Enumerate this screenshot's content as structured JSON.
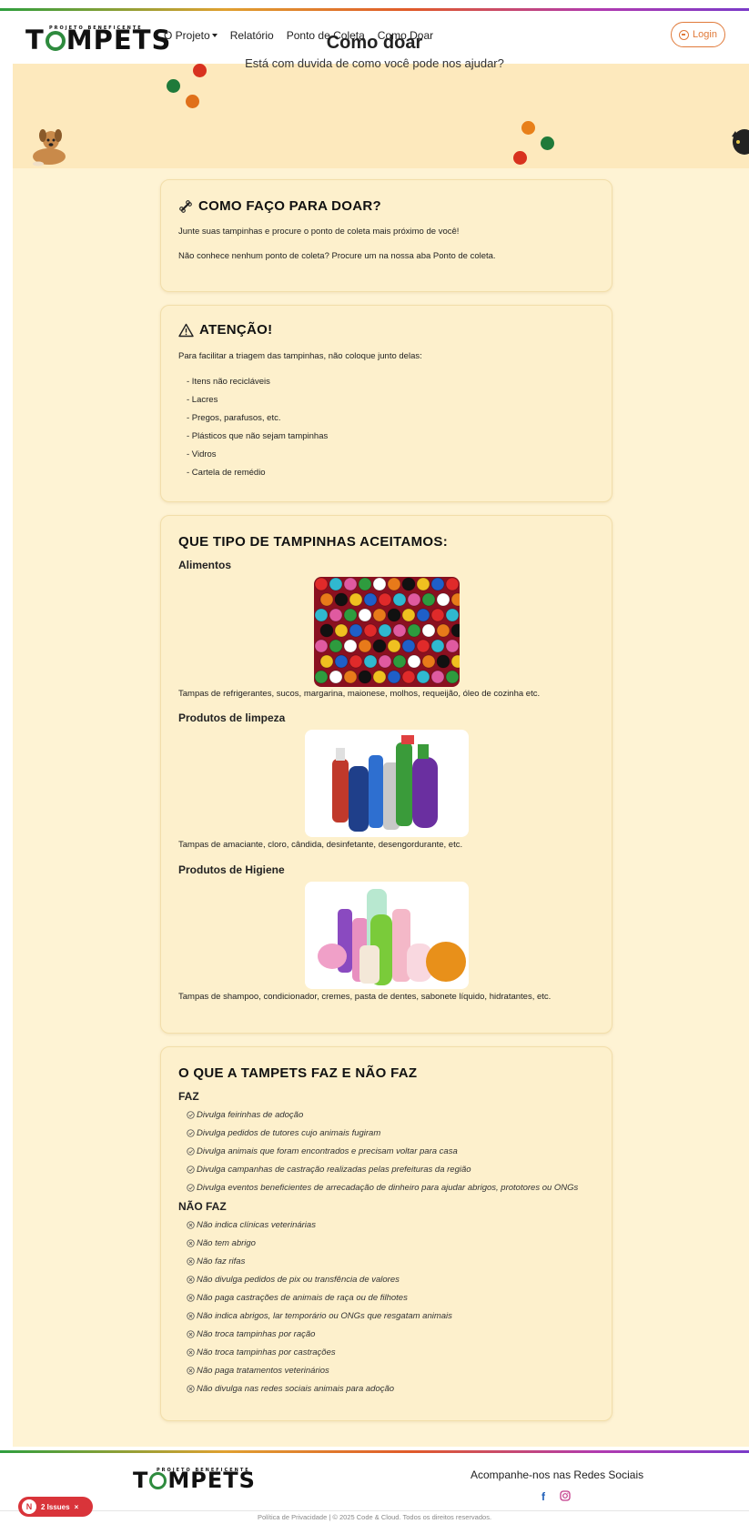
{
  "nav": {
    "logo_small": "PROJETO BENEFICENTE",
    "logo_text_before": "T",
    "logo_text_after": "MPETS",
    "links": [
      {
        "label": "O Projeto"
      },
      {
        "label": "Relatório"
      },
      {
        "label": "Ponto de Coleta"
      },
      {
        "label": "Como Doar"
      }
    ],
    "login_label": "Login"
  },
  "hero": {
    "title": "Como doar",
    "subtitle": "Está com duvida de como você pode nos ajudar?"
  },
  "card_como": {
    "title": "COMO FAÇO PARA DOAR?",
    "p1": "Junte suas tampinhas e procure o ponto de coleta mais próximo de você!",
    "p2": "Não conhece nenhum ponto de coleta? Procure um na nossa aba Ponto de coleta."
  },
  "card_atencao": {
    "title": "ATENÇÃO!",
    "intro": "Para facilitar a triagem das tampinhas, não coloque junto delas:",
    "items": [
      "- Itens não recicláveis",
      "- Lacres",
      "- Pregos, parafusos, etc.",
      "- Plásticos que não sejam tampinhas",
      "- Vidros",
      "- Cartela de remédio"
    ]
  },
  "card_tipos": {
    "title": "QUE TIPO DE TAMPINHAS ACEITAMOS:",
    "sections": [
      {
        "heading": "Alimentos",
        "caption": "Tampas de refrigerantes, sucos, margarina, maionese, molhos, requeijão, óleo de cozinha etc."
      },
      {
        "heading": "Produtos de limpeza",
        "caption": "Tampas de amaciante, cloro, cândida, desinfetante, desengordurante, etc."
      },
      {
        "heading": "Produtos de Higiene",
        "caption": "Tampas de shampoo, condicionador, cremes, pasta de dentes, sabonete líquido, hidratantes, etc."
      }
    ]
  },
  "card_faz": {
    "title": "O QUE A TAMPETS FAZ E NÃO FAZ",
    "faz_heading": "FAZ",
    "faz_items": [
      "Divulga feirinhas de adoção",
      "Divulga pedidos de tutores cujo animais fugiram",
      "Divulga animais que foram encontrados e precisam voltar para casa",
      "Divulga campanhas de castração realizadas pelas prefeituras da região",
      "Divulga eventos beneficientes de arrecadação de dinheiro para ajudar abrigos, prototores ou ONGs"
    ],
    "nao_faz_heading": "NÃO FAZ",
    "nao_faz_items": [
      "Não indica clínicas veterinárias",
      "Não tem abrigo",
      "Não faz rifas",
      "Não divulga pedidos de pix ou transfência de valores",
      "Não paga castrações de animais de raça ou de filhotes",
      "Não indica abrigos, lar temporário ou ONGs que resgatam animais",
      "Não troca tampinhas por ração",
      "Não troca tampinhas por castrações",
      "Não paga tratamentos veterinários",
      "Não divulga nas redes sociais animais para adoção"
    ]
  },
  "footer": {
    "social_title": "Acompanhe-nos nas Redes Sociais",
    "facebook": "f",
    "bottom_text": "Política de Privacidade | © 2025 Code & Cloud. Todos os direitos reservados."
  },
  "issues_badge": {
    "n": "N",
    "label": "2 Issues",
    "close": "×"
  },
  "colors": {
    "accent": "#e07a3a",
    "brand_green": "#2e8b3e",
    "background": "#fef3d4"
  }
}
